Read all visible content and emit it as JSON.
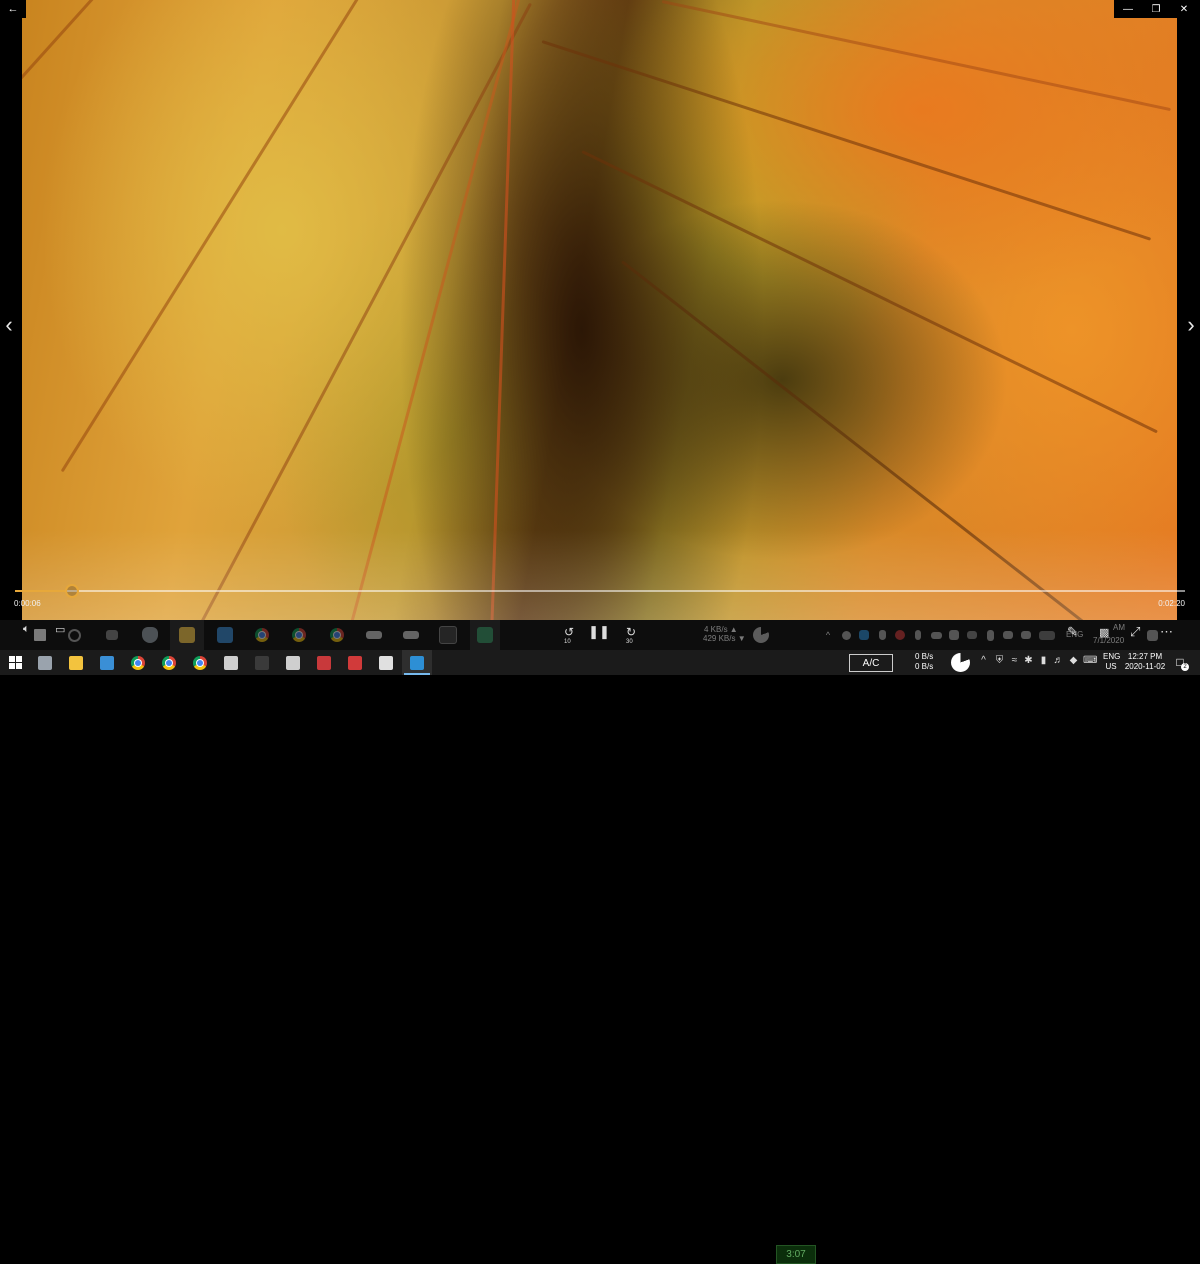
{
  "player": {
    "back_icon": "back-arrow-icon",
    "window_controls": [
      "minimize-icon",
      "restore-icon",
      "close-icon"
    ],
    "prev_icon": "chevron-left-icon",
    "next_icon": "chevron-right-icon",
    "time_elapsed": "0:00:06",
    "time_total": "0:02:20",
    "progress_fraction": 0.043,
    "accent_color": "#e7a83a",
    "skip_back_seconds": "10",
    "skip_forward_seconds": "30"
  },
  "ghost_tray": {
    "net_up": "4 KB/s ▲",
    "net_down": "429 KB/s ▼",
    "timer": "3:07",
    "lang": "ENG",
    "clock_time": "AM",
    "clock_date": "7/1/2020"
  },
  "taskbar": {
    "apps": [
      {
        "name": "shield-app",
        "color": "#9aa3ad"
      },
      {
        "name": "file-explorer",
        "color": "#f3c33e"
      },
      {
        "name": "laptop-app",
        "color": "#3a8fd6"
      },
      {
        "name": "chrome-1",
        "color": "chrome"
      },
      {
        "name": "chrome-2",
        "color": "chrome"
      },
      {
        "name": "chrome-3",
        "color": "chrome"
      },
      {
        "name": "stack-app-1",
        "color": "#cfcfcf"
      },
      {
        "name": "terminal-app",
        "color": "#3a3a3a"
      },
      {
        "name": "stack-app-2",
        "color": "#cfcfcf"
      },
      {
        "name": "pdf-app",
        "color": "#c8393b"
      },
      {
        "name": "bug-app",
        "color": "#d13a3a"
      },
      {
        "name": "settings-app",
        "color": "#e0e0e0"
      },
      {
        "name": "movies-tv-app",
        "color": "#2d8fd5"
      }
    ],
    "ac_label": "A/C",
    "net_up": "0 B/s",
    "net_down": "0 B/s",
    "lang_primary": "ENG",
    "lang_secondary": "US",
    "clock_time": "12:27 PM",
    "clock_date": "2020-11-02",
    "notification_count": "2"
  }
}
